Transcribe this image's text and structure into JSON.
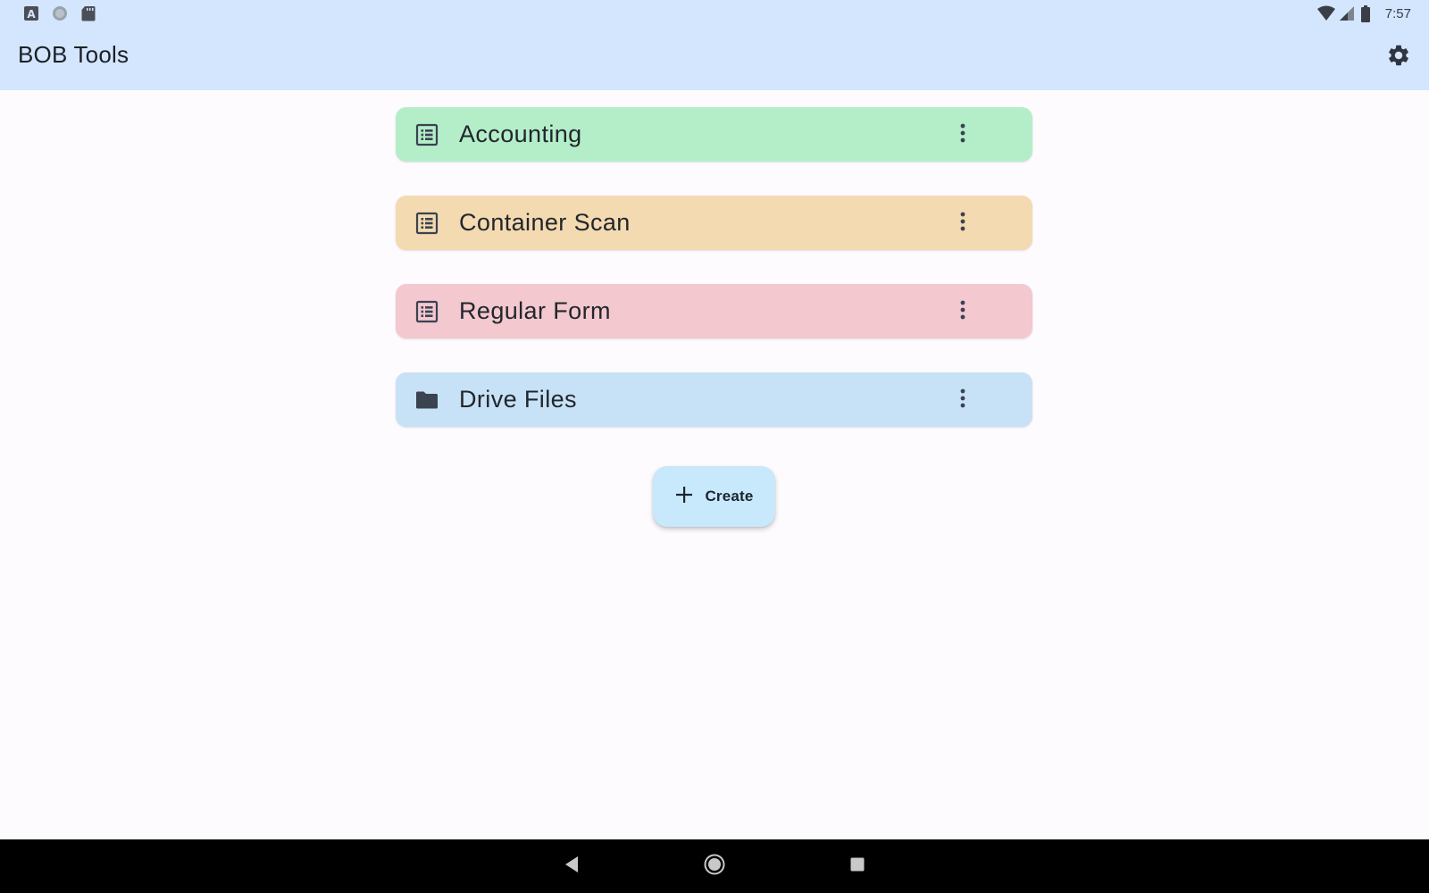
{
  "status_bar": {
    "time": "7:57",
    "left_icons": [
      "accessibility-a-icon",
      "circle-icon",
      "sd-card-icon"
    ],
    "right_icons": [
      "wifi-icon",
      "cell-signal-icon",
      "battery-icon"
    ]
  },
  "app_bar": {
    "title": "BOB Tools",
    "settings_icon": "gear-icon"
  },
  "items": [
    {
      "label": "Accounting",
      "icon": "list-icon",
      "color": "#b3eec9"
    },
    {
      "label": "Container Scan",
      "icon": "list-icon",
      "color": "#f3dab0"
    },
    {
      "label": "Regular Form",
      "icon": "list-icon",
      "color": "#f3c8cf"
    },
    {
      "label": "Drive Files",
      "icon": "folder-icon",
      "color": "#c7e2f6"
    }
  ],
  "fab": {
    "label": "Create",
    "icon": "plus-icon",
    "color": "#c7e9fb"
  },
  "nav_bar": {
    "buttons": [
      "back-icon",
      "home-icon",
      "recents-icon"
    ]
  },
  "colors": {
    "header": "#d3e6fd",
    "background": "#fefbff",
    "nav_bar": "#000000"
  }
}
